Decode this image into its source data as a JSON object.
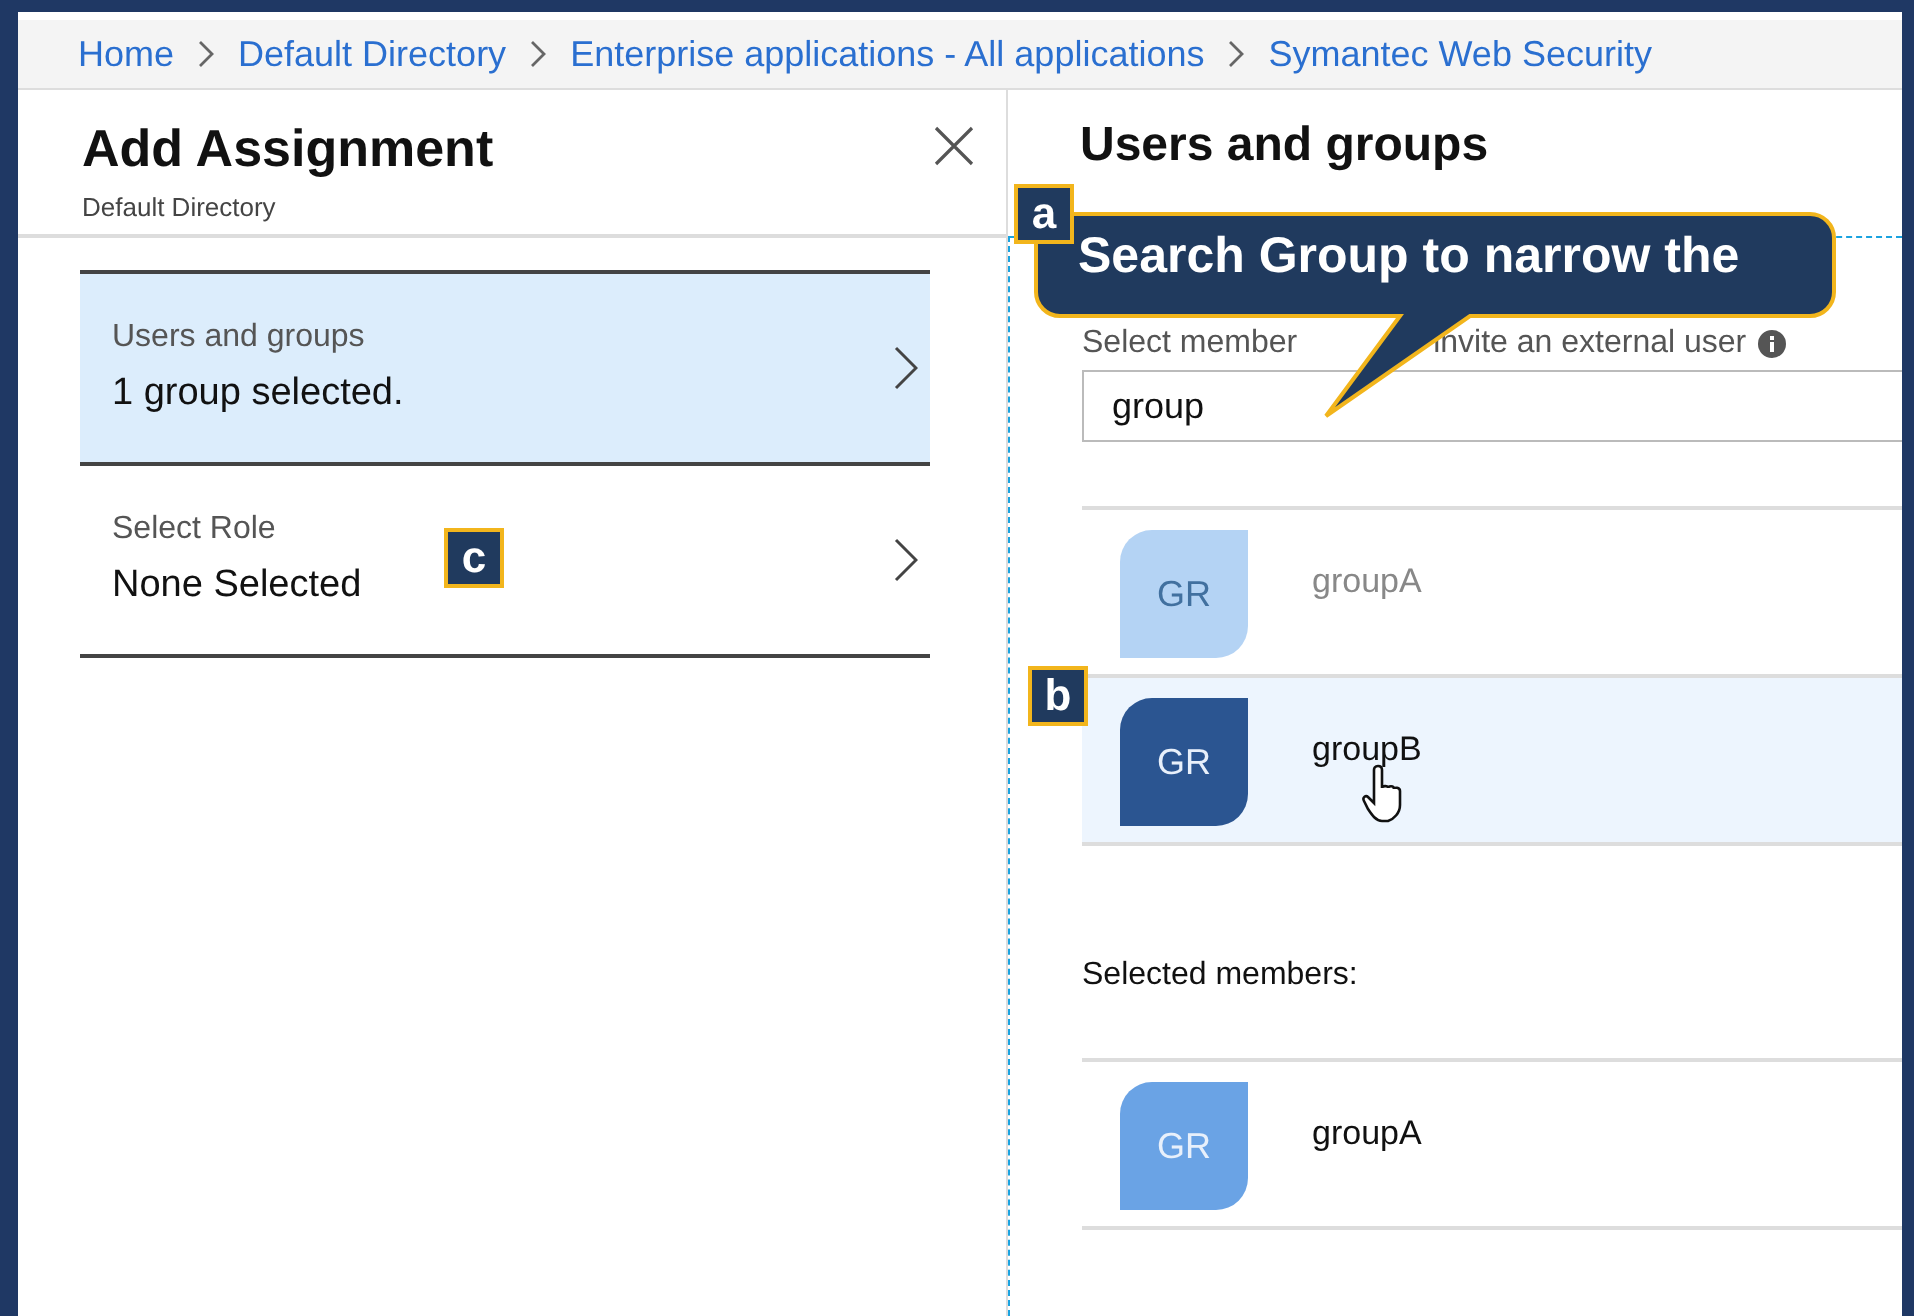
{
  "breadcrumb": [
    "Home",
    "Default Directory",
    "Enterprise applications - All applications",
    "Symantec Web Security"
  ],
  "left_panel": {
    "title": "Add Assignment",
    "subtitle": "Default Directory",
    "items": [
      {
        "label": "Users and groups",
        "value": "1 group selected.",
        "selected": true
      },
      {
        "label": "Select Role",
        "value": "None Selected",
        "selected": false
      }
    ]
  },
  "right_panel": {
    "title": "Users and groups",
    "search_label": [
      "Select member",
      "invite an external user"
    ],
    "search_value": "group",
    "results": [
      {
        "avatar": "GR",
        "name": "groupA",
        "disabled": true,
        "highlighted": false
      },
      {
        "avatar": "GR",
        "name": "groupB",
        "disabled": false,
        "highlighted": true
      }
    ],
    "selected_label": "Selected members:",
    "selected_members": [
      {
        "avatar": "GR",
        "name": "groupA"
      }
    ]
  },
  "annotations": {
    "callout": "Search **Group** to narrow the",
    "markers": [
      "a",
      "b",
      "c"
    ]
  }
}
